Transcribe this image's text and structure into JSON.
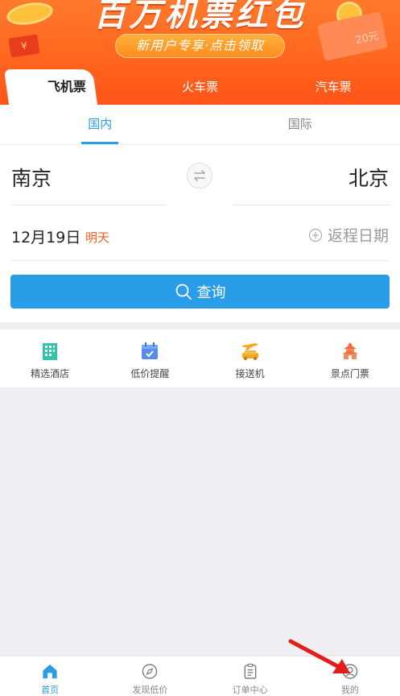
{
  "banner": {
    "title": "百万机票红包",
    "cta": "新用户专享·点击领取",
    "coupon_text": "20元",
    "tag_text": "¥"
  },
  "transport_tabs": [
    {
      "label": "飞机票",
      "active": true
    },
    {
      "label": "火车票",
      "active": false
    },
    {
      "label": "汽车票",
      "active": false
    }
  ],
  "sub_tabs": [
    {
      "label": "国内",
      "active": true
    },
    {
      "label": "国际",
      "active": false
    }
  ],
  "route": {
    "from_city": "南京",
    "to_city": "北京"
  },
  "date": {
    "depart": "12月19日",
    "depart_tag": "明天",
    "return_placeholder": "返程日期"
  },
  "search_button": "查询",
  "services": [
    {
      "label": "精选酒店",
      "icon": "hotel-icon",
      "color": "#2ec8a8"
    },
    {
      "label": "低价提醒",
      "icon": "calendar-check-icon",
      "color": "#5b8be8"
    },
    {
      "label": "接送机",
      "icon": "airport-car-icon",
      "color": "#f5a623"
    },
    {
      "label": "景点门票",
      "icon": "pagoda-icon",
      "color": "#f26b3a"
    }
  ],
  "bottom_nav": [
    {
      "label": "首页",
      "icon": "home-icon",
      "active": true
    },
    {
      "label": "发现低价",
      "icon": "compass-icon",
      "active": false
    },
    {
      "label": "订单中心",
      "icon": "clipboard-icon",
      "active": false
    },
    {
      "label": "我的",
      "icon": "profile-icon",
      "active": false
    }
  ],
  "colors": {
    "accent": "#2a9de8",
    "banner": "#ff6a20",
    "tag_orange": "#ff5a1f",
    "arrow_red": "#e51c1c"
  }
}
